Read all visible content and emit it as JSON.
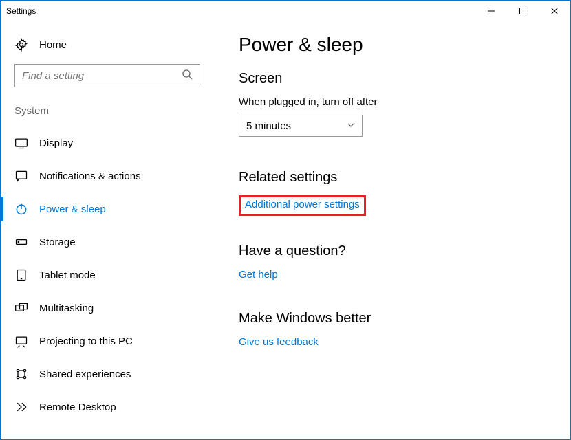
{
  "window": {
    "title": "Settings"
  },
  "home": {
    "label": "Home"
  },
  "search": {
    "placeholder": "Find a setting"
  },
  "group": {
    "label": "System"
  },
  "nav": {
    "items": [
      {
        "label": "Display"
      },
      {
        "label": "Notifications & actions"
      },
      {
        "label": "Power & sleep"
      },
      {
        "label": "Storage"
      },
      {
        "label": "Tablet mode"
      },
      {
        "label": "Multitasking"
      },
      {
        "label": "Projecting to this PC"
      },
      {
        "label": "Shared experiences"
      },
      {
        "label": "Remote Desktop"
      }
    ]
  },
  "page": {
    "title": "Power & sleep"
  },
  "screen": {
    "heading": "Screen",
    "plugged_label": "When plugged in, turn off after",
    "value": "5 minutes"
  },
  "related": {
    "heading": "Related settings",
    "link": "Additional power settings"
  },
  "question": {
    "heading": "Have a question?",
    "link": "Get help"
  },
  "better": {
    "heading": "Make Windows better",
    "link": "Give us feedback"
  }
}
